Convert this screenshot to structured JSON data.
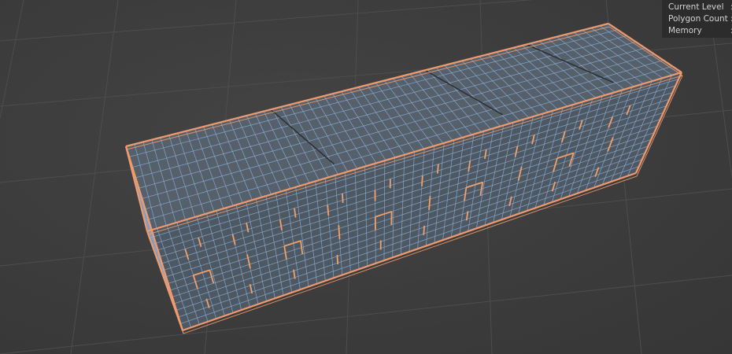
{
  "hud": {
    "rows": [
      {
        "label": "Current Level",
        "separator": ":",
        "value": ""
      },
      {
        "label": "Polygon Count",
        "separator": ":",
        "value": ""
      },
      {
        "label": "Memory",
        "separator": ":",
        "value": ""
      }
    ]
  },
  "scene": {
    "object": "box-mesh",
    "shading": "wireframe-on-shaded",
    "selection_state": "selected",
    "colors": {
      "background": "#3d3d3d",
      "floor_grid": "#4d4d4d",
      "mesh_face_top": "#55606b",
      "mesh_face_front": "#4d5862",
      "mesh_face_end": "#5a646e",
      "wire": "#8fb2dc",
      "selection_outline": "#f09a6e",
      "seam": "#2e3134",
      "marks": "#f3a06a"
    }
  }
}
